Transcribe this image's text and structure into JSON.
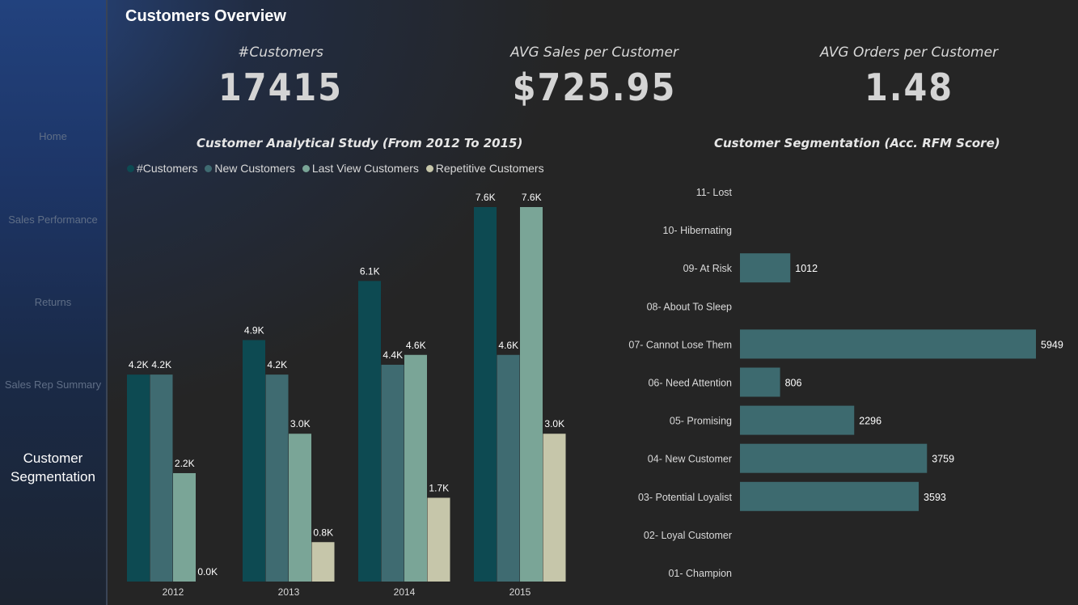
{
  "sidebar": {
    "items": [
      {
        "label": "Home",
        "active": false
      },
      {
        "label": "Sales Performance",
        "active": false
      },
      {
        "label": "Returns",
        "active": false
      },
      {
        "label": "Sales Rep Summary",
        "active": false
      },
      {
        "label": "Customer Segmentation",
        "active": true
      }
    ]
  },
  "page_title": "Customers Overview",
  "kpis": [
    {
      "label": "#Customers",
      "value": "17415"
    },
    {
      "label": "AVG Sales per Customer",
      "value": "$725.95"
    },
    {
      "label": "AVG Orders per Customer",
      "value": "1.48"
    }
  ],
  "colors": {
    "customers": "#0d4a52",
    "new_customers": "#3f6b71",
    "last_view_customers": "#7aa597",
    "repetitive_customers": "#c6c6aa",
    "segment_bar": "#3d6a6f"
  },
  "chart_data": [
    {
      "type": "bar",
      "title": "Customer Analytical Study (From 2012 To 2015)",
      "categories": [
        "2012",
        "2013",
        "2014",
        "2015"
      ],
      "series": [
        {
          "name": "#Customers",
          "values": [
            4.2,
            4.9,
            6.1,
            7.6
          ],
          "labels": [
            "4.2K",
            "4.9K",
            "6.1K",
            "7.6K"
          ]
        },
        {
          "name": "New Customers",
          "values": [
            4.2,
            4.2,
            4.4,
            4.6
          ],
          "labels": [
            "4.2K",
            "4.2K",
            "4.4K",
            "4.6K"
          ]
        },
        {
          "name": "Last View Customers",
          "values": [
            2.2,
            3.0,
            4.6,
            7.6
          ],
          "labels": [
            "2.2K",
            "3.0K",
            "4.6K",
            "7.6K"
          ]
        },
        {
          "name": "Repetitive Customers",
          "values": [
            0.0,
            0.8,
            1.7,
            3.0
          ],
          "labels": [
            "0.0K",
            "0.8K",
            "1.7K",
            "3.0K"
          ]
        }
      ],
      "unit": "K",
      "legend": "top-left",
      "grid": false
    },
    {
      "type": "bar",
      "orientation": "horizontal",
      "title": "Customer Segmentation (Acc. RFM Score)",
      "categories": [
        "11- Lost",
        "10- Hibernating",
        "09- At Risk",
        "08- About To Sleep",
        "07- Cannot Lose Them",
        "06- Need Attention",
        "05- Promising",
        "04- New Customer",
        "03- Potential Loyalist",
        "02- Loyal Customer",
        "01- Champion"
      ],
      "values": [
        null,
        null,
        1012,
        null,
        5949,
        806,
        2296,
        3759,
        3593,
        null,
        null
      ],
      "grid": false
    }
  ]
}
